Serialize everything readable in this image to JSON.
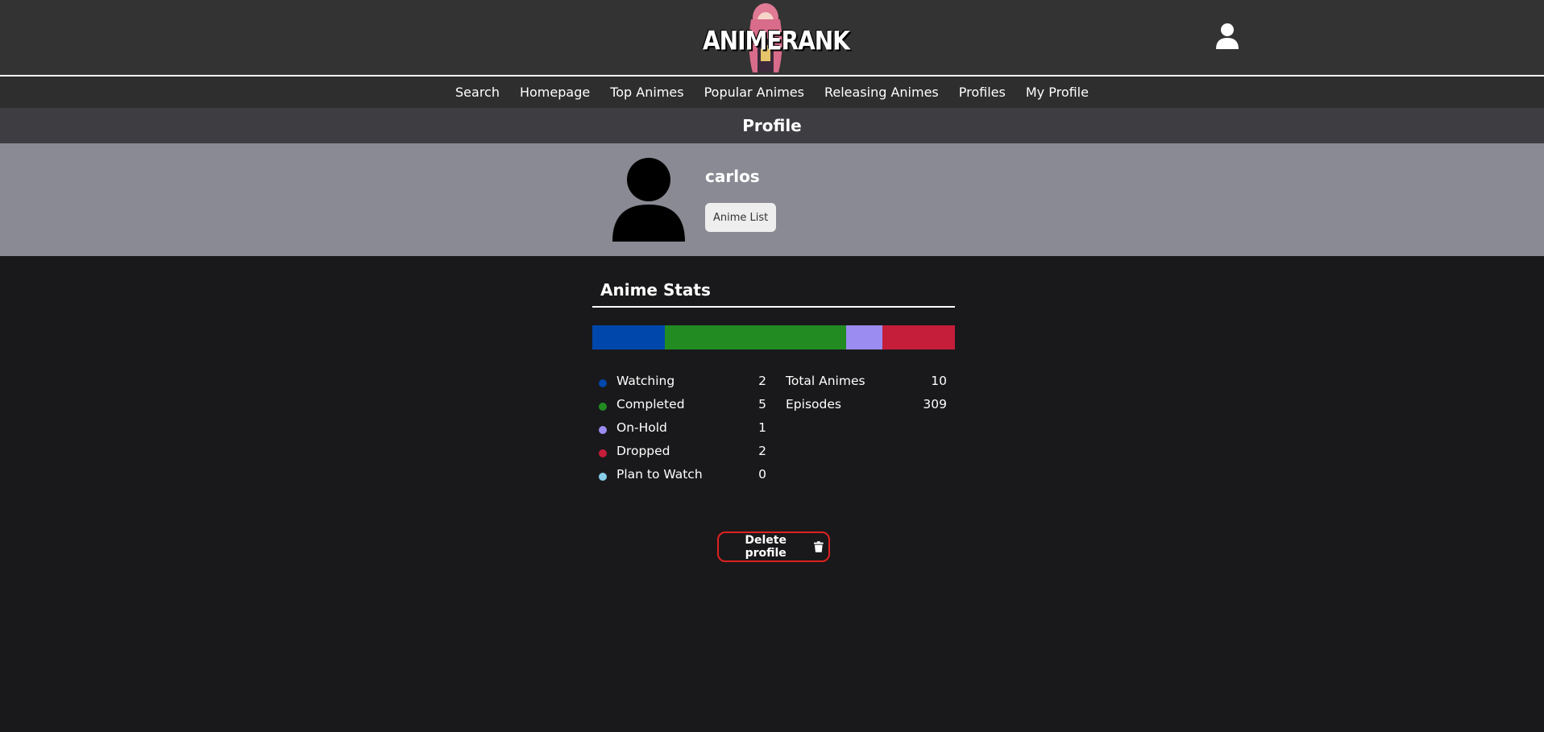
{
  "header": {
    "logo_text": "ANIMERANK",
    "user_icon": "user-icon"
  },
  "nav": {
    "items": [
      "Search",
      "Homepage",
      "Top Animes",
      "Popular Animes",
      "Releasing Animes",
      "Profiles",
      "My Profile"
    ]
  },
  "page": {
    "title": "Profile"
  },
  "profile": {
    "username": "carlos",
    "anime_list_label": "Anime List",
    "avatar_icon": "avatar-icon"
  },
  "stats": {
    "title": "Anime Stats",
    "colors": {
      "watching": "#0047ab",
      "completed": "#228b22",
      "onhold": "#9a8cf0",
      "dropped": "#c41e3a",
      "plan": "#87ceeb"
    },
    "rows": [
      {
        "label": "Watching",
        "value": "2"
      },
      {
        "label": "Completed",
        "value": "5"
      },
      {
        "label": "On-Hold",
        "value": "1"
      },
      {
        "label": "Dropped",
        "value": "2"
      },
      {
        "label": "Plan to Watch",
        "value": "0"
      }
    ],
    "totals": [
      {
        "label": "Total Animes",
        "value": "10"
      },
      {
        "label": "Episodes",
        "value": "309"
      }
    ]
  },
  "actions": {
    "delete_label": "Delete profile",
    "delete_icon": "trash-icon"
  }
}
